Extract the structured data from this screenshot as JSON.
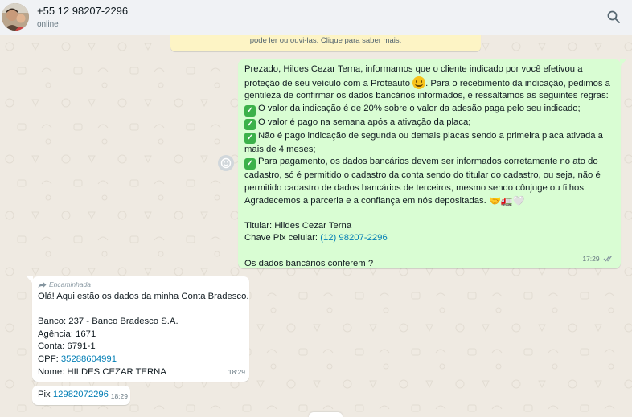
{
  "header": {
    "contact_name": "+55 12 98207-2296",
    "status": "online",
    "search_icon": "search-icon",
    "avatar_icon": "avatar"
  },
  "system_notice": {
    "text": "pode ler ou ouvi-las. Clique para saber mais."
  },
  "outgoing_message": {
    "line1": "Prezado, Hildes Cezar Terna, informamos que o cliente indicado por você efetivou a",
    "line2a": "proteção de seu veículo com a Proteauto ",
    "line2b": ". Para o recebimento da indicação, pedimos a",
    "line3": "gentileza de confirmar os dados bancários informados, e  ressaltamos as seguintes regras:",
    "rule1": "O valor da indicação é de 20% sobre o valor da adesão paga pelo seu indicado;",
    "rule2": "O valor é pago na semana após a ativação da placa;",
    "rule3a": "Não é pago indicação de segunda ou demais placas sendo a primeira placa ativada a",
    "rule3b": "mais de 4 meses;",
    "rule4a": "Para pagamento, os dados bancários devem ser informados corretamente no ato do",
    "rule4b": "cadastro, só é permitido o cadastro da conta sendo do titular do cadastro, ou seja, não é",
    "rule4c": "permitido cadastro de dados bancários de terceiros, mesmo sendo cônjuge ou filhos.",
    "thanks": "Agradecemos a parceria e a confiança em nós depositadas. ",
    "holder": "Titular: Hildes Cezar Terna",
    "pix_label": "Chave Pix celular:  ",
    "pix_value": "(12) 98207-2296",
    "question": "Os dados bancários conferem ?",
    "time": "17:29",
    "status_icon": "double-check-icon",
    "check_glyph": "✓",
    "emojis_thanks": "🤝🚛🤍"
  },
  "incoming_message_1": {
    "forwarded_label": "Encaminhada",
    "line1": "Olá! Aqui estão os dados da minha Conta Bradesco.",
    "bank": "Banco: 237 - Banco Bradesco S.A.",
    "agency": "Agência: 1671",
    "account": "Conta: 6791-1",
    "cpf_label": "CPF: ",
    "cpf_value": "35288604991",
    "name": "Nome: HILDES CEZAR TERNA",
    "time": "18:29"
  },
  "incoming_message_2": {
    "pix_label": "Pix ",
    "pix_value": "12982072296",
    "time": "18:29"
  },
  "colors": {
    "outgoing_bubble": "#d9fdd3",
    "incoming_bubble": "#ffffff",
    "chat_background": "#efeae2",
    "link": "#027eb5",
    "read_check": "#8696a0"
  }
}
